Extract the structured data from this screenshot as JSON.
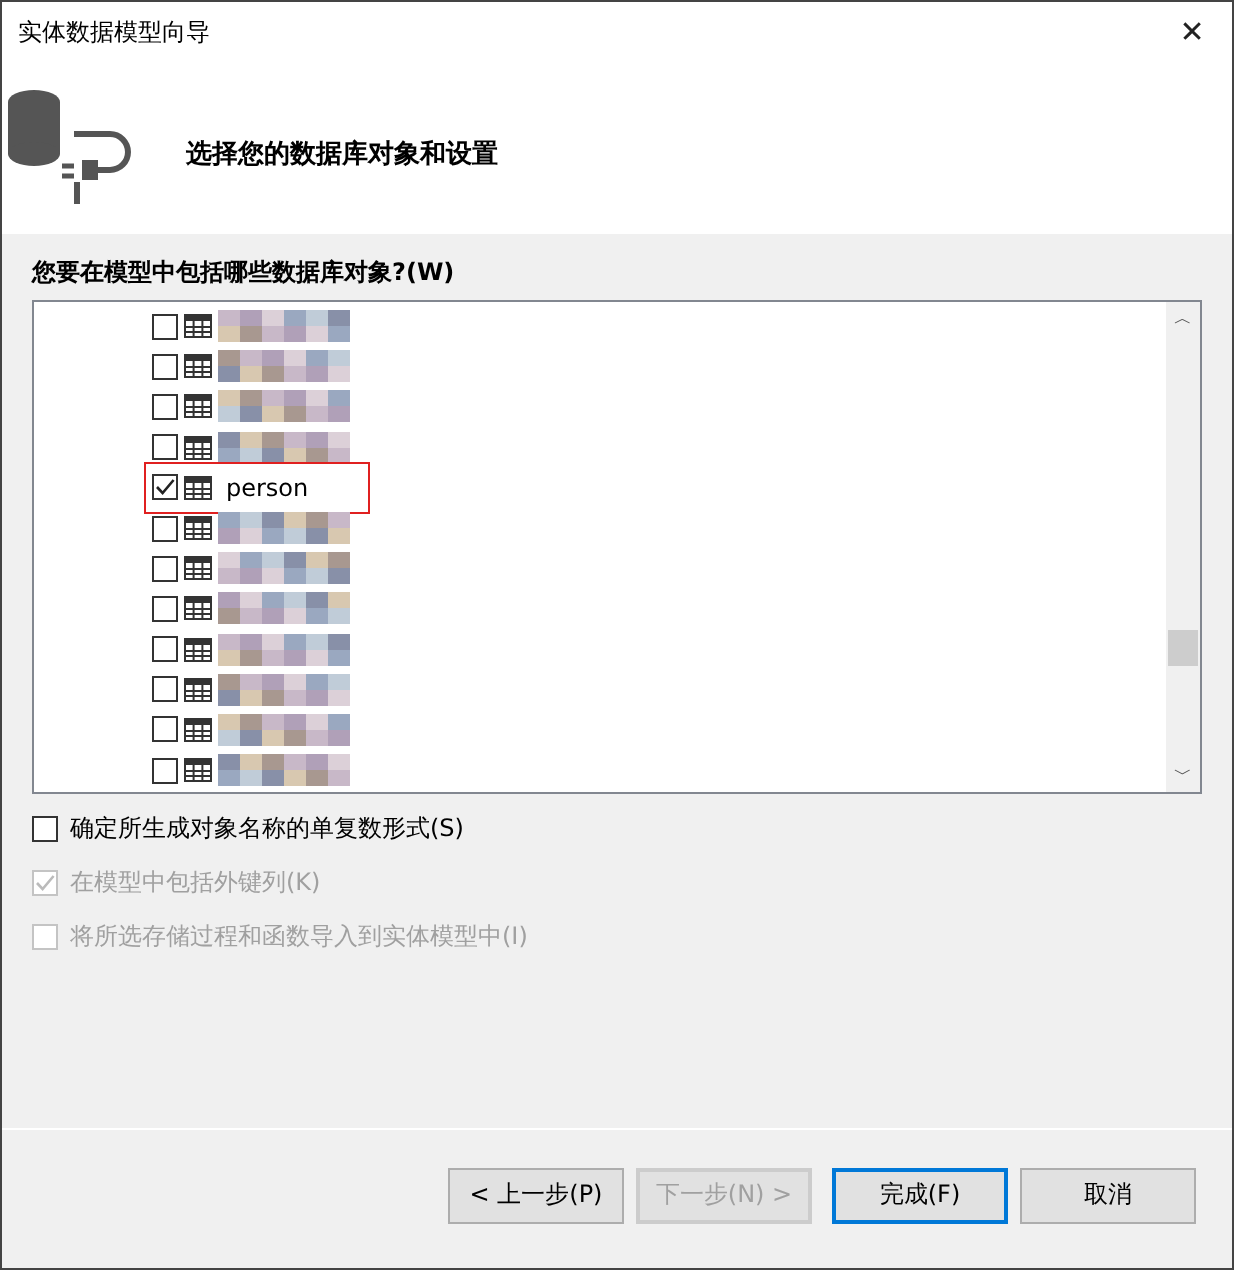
{
  "window": {
    "title": "实体数据模型向导",
    "close": "✕"
  },
  "header": {
    "heading": "选择您的数据库对象和设置"
  },
  "objects": {
    "label": "您要在模型中包括哪些数据库对象?(W)",
    "items": [
      {
        "kind": "redacted",
        "checked": false
      },
      {
        "kind": "redacted",
        "checked": false
      },
      {
        "kind": "redacted",
        "checked": false
      },
      {
        "kind": "redacted",
        "checked": false
      },
      {
        "kind": "table",
        "name": "person",
        "checked": true,
        "highlighted": true
      },
      {
        "kind": "redacted",
        "checked": false
      },
      {
        "kind": "redacted",
        "checked": false
      },
      {
        "kind": "redacted",
        "checked": false
      },
      {
        "kind": "redacted",
        "checked": false
      },
      {
        "kind": "redacted",
        "checked": false
      },
      {
        "kind": "redacted",
        "checked": false
      },
      {
        "kind": "redacted",
        "checked": false
      }
    ],
    "scroll_up": "︿",
    "scroll_down": "﹀"
  },
  "options": [
    {
      "label": "确定所生成对象名称的单复数形式(S)",
      "checked": false,
      "disabled": false
    },
    {
      "label": "在模型中包括外键列(K)",
      "checked": true,
      "disabled": true
    },
    {
      "label": "将所选存储过程和函数导入到实体模型中(I)",
      "checked": false,
      "disabled": true
    }
  ],
  "buttons": [
    {
      "label": "< 上一步(P)",
      "disabled": false,
      "default": false
    },
    {
      "label": "下一步(N) >",
      "disabled": true,
      "default": false
    },
    {
      "label": "完成(F)",
      "disabled": false,
      "default": true
    },
    {
      "label": "取消",
      "disabled": false,
      "default": false
    }
  ]
}
